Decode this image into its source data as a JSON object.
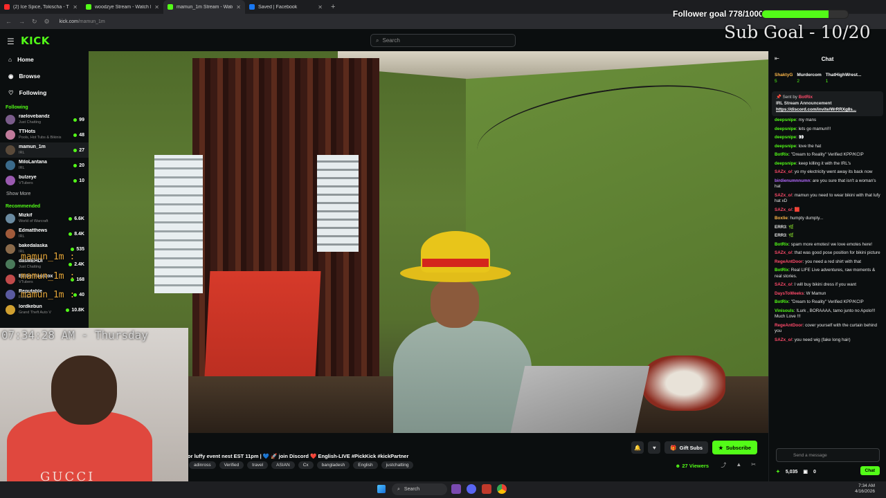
{
  "browser": {
    "tabs": [
      {
        "label": "(2) Ice Spice, Tokischa - The",
        "color": "#ff2a2a",
        "active": false
      },
      {
        "label": "woodzye Stream - Watch Live",
        "color": "#53fc18",
        "active": false
      },
      {
        "label": "mamun_1m Stream - Watch",
        "color": "#53fc18",
        "active": true
      },
      {
        "label": "Saved | Facebook",
        "color": "#1877f2",
        "active": false
      }
    ],
    "new_tab": "+",
    "url_host": "kick.com",
    "url_path": "/mamun_1m"
  },
  "header": {
    "logo": "KICK",
    "search_placeholder": "Search"
  },
  "sidebar": {
    "nav": [
      {
        "label": "Home",
        "icon": "home-icon",
        "glyph": "⌂"
      },
      {
        "label": "Browse",
        "icon": "compass-icon",
        "glyph": "◉"
      },
      {
        "label": "Following",
        "icon": "heart-icon",
        "glyph": "♡"
      }
    ],
    "following_title": "Following",
    "following": [
      {
        "name": "raelovebandz",
        "game": "Just Chatting",
        "count": "99",
        "color": "#7a5c8a"
      },
      {
        "name": "TTHots",
        "game": "Pools, Hot Tubs & Bikinis",
        "count": "48",
        "color": "#c07a9a"
      },
      {
        "name": "mamun_1m",
        "game": "IRL",
        "count": "27",
        "color": "#5a4a3a"
      },
      {
        "name": "MiloLantana",
        "game": "IRL",
        "count": "20",
        "color": "#3a6a8a"
      },
      {
        "name": "bulzeye",
        "game": "VTubers",
        "count": "10",
        "color": "#9a5ab0"
      }
    ],
    "show_more": "Show More",
    "recommended_title": "Recommended",
    "recommended": [
      {
        "name": "Mizkif",
        "game": "World of Warcraft",
        "count": "6.6K",
        "color": "#6a8aa0"
      },
      {
        "name": "Edmatthews",
        "game": "IRL",
        "count": "8.4K",
        "color": "#a05a3a"
      },
      {
        "name": "bakedalaska",
        "game": "IRL",
        "count": "535",
        "color": "#8a6a4a"
      },
      {
        "name": "dasMEHDI",
        "game": "Just Chatting",
        "count": "2.4K",
        "color": "#4a7a5a"
      },
      {
        "name": "EmberParadox",
        "game": "VTubers",
        "count": "168",
        "color": "#c04a4a"
      },
      {
        "name": "Reputable",
        "game": "Fortnite",
        "count": "40",
        "color": "#5a5aa0"
      },
      {
        "name": "lordkebun",
        "game": "Grand Theft Auto V",
        "count": "10.8K",
        "color": "#d0a030"
      }
    ]
  },
  "stream": {
    "title": "or luffy event nest EST 11pm | 💙 🚀 join Discord ❤️ English-LIVE #PickKick #kickPartner",
    "tags": [
      "adinross",
      "Verified",
      "travel",
      "ASIAN",
      "Cx",
      "bangladesh",
      "English",
      "justchatting"
    ],
    "gift_label": "Gift Subs",
    "subscribe_label": "Subscribe",
    "viewers": "27 Viewers"
  },
  "chat": {
    "title": "Chat",
    "top_gifters": [
      {
        "name": "ShaktyG",
        "count": "5"
      },
      {
        "name": "Murdercom",
        "count": "2"
      },
      {
        "name": "ThatHighWrest...",
        "count": "1"
      }
    ],
    "pinned": {
      "sent_by": "Sent by",
      "sender": "BotRix",
      "text": "IRL Stream Announcement",
      "link": "https://discord.com/invite/WrRRXg8s..."
    },
    "messages": [
      {
        "user": "deepsnipe",
        "color": "#53fc18",
        "text": "my mans"
      },
      {
        "user": "deepsnipe",
        "color": "#53fc18",
        "text": "lets go mamun!!!"
      },
      {
        "user": "deepsnipe",
        "color": "#53fc18",
        "text": "👀"
      },
      {
        "user": "deepsnipe",
        "color": "#53fc18",
        "text": "love the hat"
      },
      {
        "user": "BotRix",
        "color": "#53fc18",
        "text": "\"Dream to Reality\" Verified KPP/KCIP"
      },
      {
        "user": "deepsnipe",
        "color": "#53fc18",
        "text": "keep killing it with the IRL's"
      },
      {
        "user": "SAZx_o/",
        "color": "#ff4a6a",
        "text": "yo my electricity went away its back now"
      },
      {
        "user": "birdienumnnumn",
        "color": "#b46aff",
        "text": "are you sure that isn't a woman's hat"
      },
      {
        "user": "SAZx_o/",
        "color": "#ff4a6a",
        "text": "mamun you need to wear bikini with that lufy hat xD"
      },
      {
        "user": "SAZx_o/",
        "color": "#ff4a6a",
        "text": "🟥"
      },
      {
        "user": "Boxlie",
        "color": "#ffb84a",
        "text": "humpty dumpty..."
      },
      {
        "user": "ERR3",
        "color": "#e6e6e6",
        "text": "🌿"
      },
      {
        "user": "ERR3",
        "color": "#e6e6e6",
        "text": "🌿"
      },
      {
        "user": "BotRix",
        "color": "#53fc18",
        "text": "spam more emotes! we love emotes here!"
      },
      {
        "user": "SAZx_o/",
        "color": "#ff4a6a",
        "text": "that was good pose position for bikini picture"
      },
      {
        "user": "RegeAntDoor",
        "color": "#ff4a6a",
        "text": "you need a red shirt with that"
      },
      {
        "user": "BotRix",
        "color": "#53fc18",
        "text": "Real LIFE Live adventures, raw moments & real stories."
      },
      {
        "user": "SAZx_o/",
        "color": "#ff4a6a",
        "text": "I will buy bikini dress if you want"
      },
      {
        "user": "DaysToWeeks",
        "color": "#ff4a6a",
        "text": "W Mamun"
      },
      {
        "user": "BotRix",
        "color": "#53fc18",
        "text": "\"Dream to Reality\" Verified KPP/KCIP"
      },
      {
        "user": "Vinisouls",
        "color": "#53fc18",
        "text": "!Lurk , BORAAAA, tamo junto no Apolo!!! Much Love !!!"
      },
      {
        "user": "RegeAntDoor",
        "color": "#ff4a6a",
        "text": "cover yourself with the curtain behind you"
      },
      {
        "user": "SAZx_o/",
        "color": "#ff4a6a",
        "text": "you need wig (fake long hair)"
      }
    ],
    "input_placeholder": "Send a message",
    "points": "5,035",
    "zero": "0",
    "chat_button": "Chat"
  },
  "overlay": {
    "follower_goal": "Follower goal 778/1000",
    "follower_progress": 0.778,
    "sub_goal": "Sub Goal - 10/20",
    "clock": "07:34:28 AM - Thursday",
    "names": [
      "mamun_1m :",
      "mamun_1m :",
      "mamun_1m :"
    ],
    "webcam_shirt": "GUCCI",
    "kick_count": "5"
  },
  "taskbar": {
    "search": "Search",
    "time": "7:34 AM",
    "date": "4/16/2026"
  }
}
